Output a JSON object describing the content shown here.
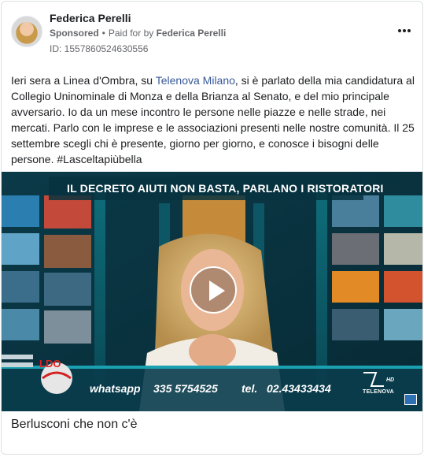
{
  "post": {
    "author_name": "Federica Perelli",
    "sponsored_label": "Sponsored",
    "separator": "•",
    "paid_for_prefix": "Paid for by",
    "paid_for_name": "Federica Perelli",
    "ad_id": "ID: 1557860524630556",
    "more_icon": "more-horizontal-icon",
    "text_part1": "Ieri sera a Linea d'Ombra, su ",
    "text_link": "Telenova Milano",
    "text_part2": ", si è parlato della mia candidatura al Collegio Uninominale di Monza e della Brianza al Senato, e del mio principale avversario. Io da un mese incontro le persone nelle piazze e nelle strade, nei mercati. Parlo con le imprese e le associazioni presenti nelle nostre comunità. Il 25 settembre scegli chi è presente, giorno per giorno, e conosce i bisogni delle persone. #Lasceltapiùbella",
    "link_color": "#385898"
  },
  "video": {
    "headline": "IL DECRETO AIUTI NON BASTA, PARLANO I RISTORATORI",
    "whatsapp_label": "whatsapp",
    "whatsapp_number": "335 5754525",
    "tel_label": "tel.",
    "tel_number": "02.43433434",
    "channel_logo": "LDO",
    "broadcaster_logo": "TELENOVA",
    "broadcaster_hd": "HD",
    "play_icon": "play-icon"
  },
  "caption": "Berlusconi che non c'è"
}
